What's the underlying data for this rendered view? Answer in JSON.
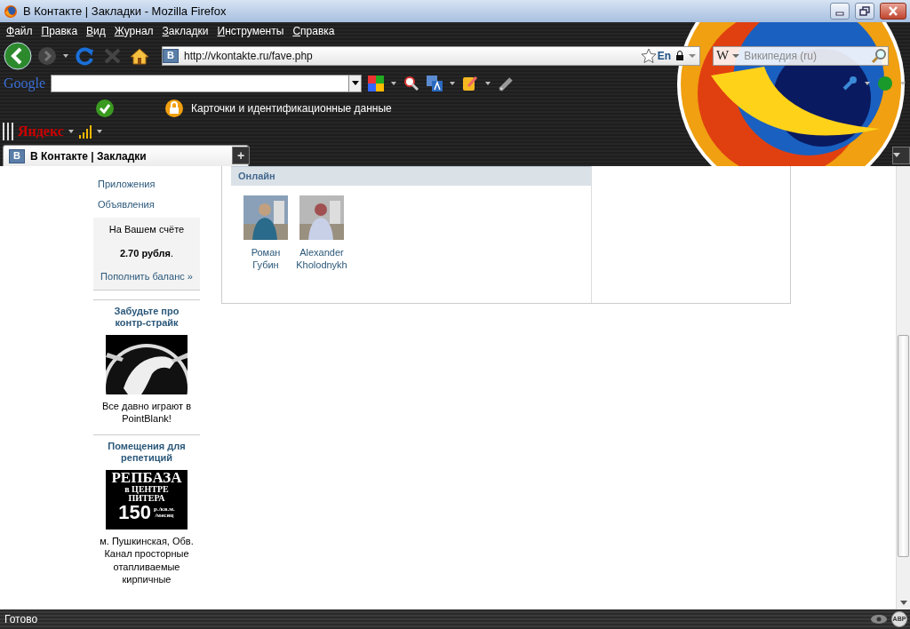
{
  "window": {
    "title": "В Контакте | Закладки - Mozilla Firefox"
  },
  "menu": [
    "Файл",
    "Правка",
    "Вид",
    "Журнал",
    "Закладки",
    "Инструменты",
    "Справка"
  ],
  "address_bar": {
    "site_badge": "В",
    "url": "http://vkontakte.ru/fave.php",
    "language": "En"
  },
  "search_bar": {
    "engine_badge": "W",
    "placeholder": "Википедия (ru)"
  },
  "google_toolbar": {
    "logo": "Google"
  },
  "password_toolbar": {
    "label": "Карточки и идентификационные данные"
  },
  "yandex_toolbar": {
    "logo": "Яндекс"
  },
  "tabs": [
    {
      "badge": "В",
      "label": "В Контакте | Закладки",
      "selected": true
    }
  ],
  "new_tab": "+",
  "sidebar": {
    "links": [
      "Приложения",
      "Объявления"
    ],
    "balance": {
      "caption": "На Вашем счёте",
      "amount": "**2.70 рубля**.",
      "link": "Пополнить баланс »"
    },
    "ads": [
      {
        "kind": "picture",
        "title": "Забудьте про контр-страйк",
        "text": "Все давно играют в PointBlank!"
      },
      {
        "kind": "banner",
        "title": "Помещения для репетиций",
        "banner": {
          "name": "РЕПБАЗА",
          "line_1": "в ЦЕНТРЕ",
          "line_2": "ПИТЕРА",
          "price": "150",
          "unit": "р./кв.м.",
          "period": "/месяц"
        },
        "text": "м. Пушкинская, Обв. Канал просторные отапливаемые кирпичные"
      }
    ]
  },
  "online": {
    "heading": "Онлайн",
    "friends": [
      {
        "first_name": "Роман",
        "last_name": "Губин"
      },
      {
        "first_name": "Alexander",
        "last_name": "Kholodnykh"
      }
    ]
  },
  "status_bar": {
    "text": "Готово",
    "adblock": "ABP"
  }
}
